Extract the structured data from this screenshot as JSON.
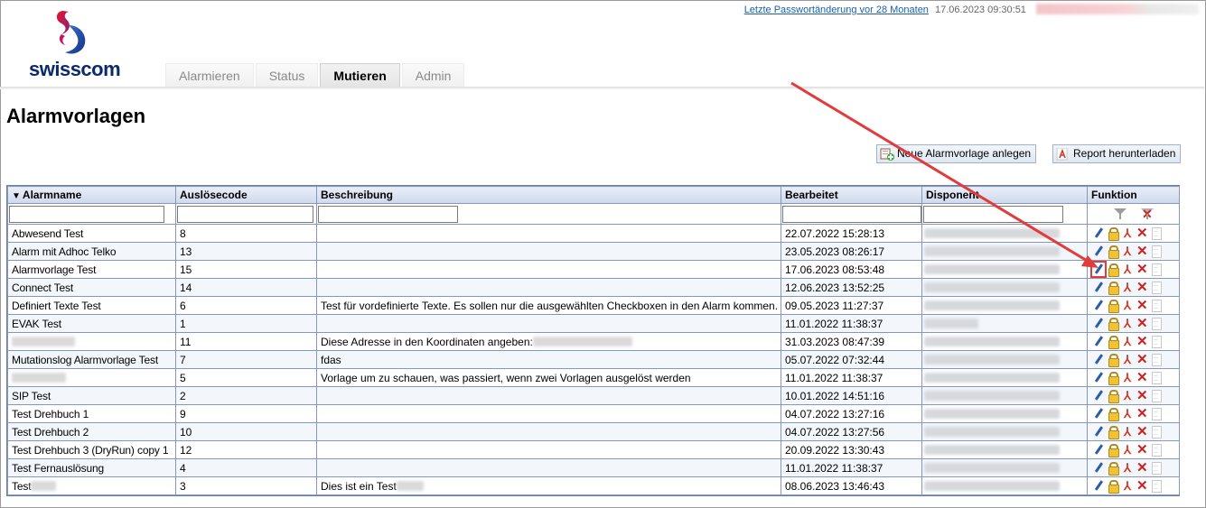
{
  "header": {
    "password_link": "Letzte Passwortänderung vor 28 Monaten",
    "timestamp": "17.06.2023 09:30:51",
    "logo_text": "swisscom",
    "tabs": [
      {
        "label": "Alarmieren",
        "active": false
      },
      {
        "label": "Status",
        "active": false
      },
      {
        "label": "Mutieren",
        "active": true
      },
      {
        "label": "Admin",
        "active": false
      }
    ]
  },
  "page": {
    "title": "Alarmvorlagen",
    "new_button": "Neue Alarmvorlage anlegen",
    "report_button": "Report herunterladen"
  },
  "table": {
    "columns": [
      "Alarmname",
      "Auslösecode",
      "Beschreibung",
      "Bearbeitet",
      "Disponent",
      "Funktion"
    ],
    "rows": [
      {
        "name": "Abwesend Test",
        "code": "8",
        "desc": "",
        "edited": "22.07.2022 15:28:13"
      },
      {
        "name": "Alarm mit Adhoc Telko",
        "code": "13",
        "desc": "",
        "edited": "23.05.2023 08:26:17"
      },
      {
        "name": "Alarmvorlage Test",
        "code": "15",
        "desc": "",
        "edited": "17.06.2023 08:53:48"
      },
      {
        "name": "Connect Test",
        "code": "14",
        "desc": "",
        "edited": "12.06.2023 13:52:25"
      },
      {
        "name": "Definiert Texte Test",
        "code": "6",
        "desc": "Test für vordefinierte Texte. Es sollen nur die ausgewählten Checkboxen in den Alarm kommen.",
        "edited": "09.05.2023 11:27:37"
      },
      {
        "name": "EVAK Test",
        "code": "1",
        "desc": "",
        "edited": "11.01.2022 11:38:37"
      },
      {
        "name": "",
        "code": "11",
        "desc": "Diese Adresse in den Koordinaten angeben:",
        "edited": "31.03.2023 08:47:39"
      },
      {
        "name": "Mutationslog Alarmvorlage Test",
        "code": "7",
        "desc": "fdas",
        "edited": "05.07.2022 07:32:44"
      },
      {
        "name": "",
        "code": "5",
        "desc": "Vorlage um zu schauen, was passiert, wenn zwei Vorlagen ausgelöst werden",
        "edited": "11.01.2022 11:38:37"
      },
      {
        "name": "SIP Test",
        "code": "2",
        "desc": "",
        "edited": "10.01.2022 14:51:16"
      },
      {
        "name": "Test Drehbuch 1",
        "code": "9",
        "desc": "",
        "edited": "04.07.2022 13:27:16"
      },
      {
        "name": "Test Drehbuch 2",
        "code": "10",
        "desc": "",
        "edited": "04.07.2022 13:27:56"
      },
      {
        "name": "Test Drehbuch 3 (DryRun) copy 1",
        "code": "12",
        "desc": "",
        "edited": "20.09.2022 13:30:43"
      },
      {
        "name": "Test Fernauslösung",
        "code": "4",
        "desc": "",
        "edited": "11.01.2022 11:38:37"
      },
      {
        "name": "Test",
        "code": "3",
        "desc": "Dies ist ein Test",
        "edited": "08.06.2023 13:46:43"
      }
    ]
  },
  "colors": {
    "annotation_arrow": "#e23b3b",
    "header_grad": "#cfd9ec",
    "grid_border": "#8597bb"
  }
}
